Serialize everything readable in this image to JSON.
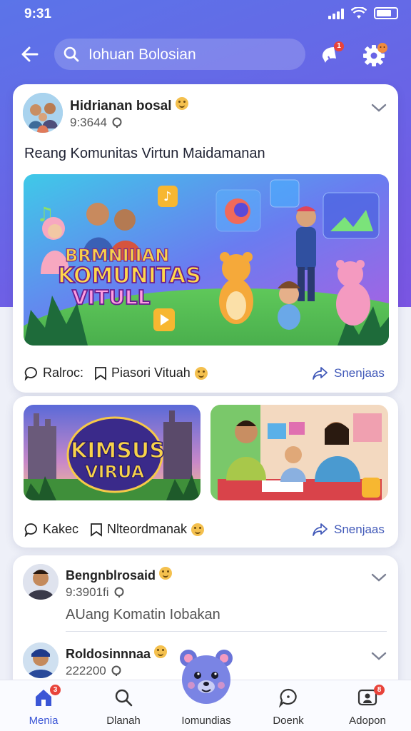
{
  "status_bar": {
    "time": "9:31"
  },
  "top_bar": {
    "search_text": "Iohuan Bolosian",
    "notification_badge": "1"
  },
  "post_main": {
    "author": "Hidrianan bosal",
    "timestamp": "9:3644",
    "caption": "Reang Komunitas Virtun Maidamanan",
    "banner_text": [
      "BRMNIIIAN",
      "KOMUNITAS",
      "VITULL"
    ],
    "actions": {
      "comment": "Ralroc:",
      "save": "Piasori Vituah",
      "share": "Snenjaas"
    }
  },
  "post_gallery": {
    "left_banner_text": [
      "KIMSUS",
      "VIRUA"
    ],
    "actions": {
      "comment": "Kakec",
      "save": "Nlteordmanak",
      "share": "Snenjaas"
    }
  },
  "post_list": {
    "items": [
      {
        "author": "Bengnblrosaid",
        "timestamp": "9:3901fi",
        "caption": "AUang Komatin Iobakan"
      },
      {
        "author": "Roldosinnnaa",
        "timestamp": "222200"
      }
    ]
  },
  "bottom_nav": {
    "items": [
      {
        "label": "Menia",
        "badge": "3"
      },
      {
        "label": "Dlanah"
      },
      {
        "label": "Iomundias"
      },
      {
        "label": "Doenk"
      },
      {
        "label": "Adopon",
        "badge": "8"
      }
    ]
  },
  "colors": {
    "accent": "#3b56d6",
    "header": "#6a63e6",
    "badge": "#e8433a"
  }
}
